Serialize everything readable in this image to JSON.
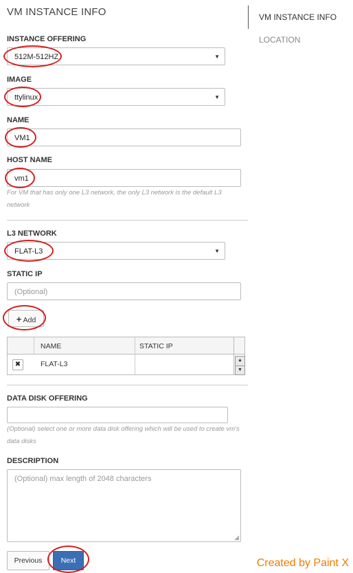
{
  "header": {
    "title": "VM INSTANCE INFO"
  },
  "sidebar": {
    "items": [
      {
        "label": "VM INSTANCE INFO"
      },
      {
        "label": "LOCATION"
      }
    ]
  },
  "form": {
    "instance_offering": {
      "label": "INSTANCE OFFERING",
      "value": "512M-512HZ"
    },
    "image": {
      "label": "IMAGE",
      "value": "ttylinux"
    },
    "name": {
      "label": "NAME",
      "value": "VM1"
    },
    "host_name": {
      "label": "HOST NAME",
      "value": "vm1",
      "hint": "For VM that has only one L3 network, the only L3 network is the default L3 network"
    },
    "l3_network": {
      "label": "L3 NETWORK",
      "value": "FLAT-L3"
    },
    "static_ip": {
      "label": "STATIC IP",
      "placeholder": "(Optional)"
    },
    "add_button": {
      "label": "Add"
    },
    "network_table": {
      "columns": [
        "NAME",
        "STATIC IP"
      ],
      "rows": [
        {
          "name": "FLAT-L3",
          "static_ip": ""
        }
      ]
    },
    "data_disk": {
      "label": "DATA DISK OFFERING",
      "value": "",
      "hint": "(Optional) select one or more data disk offering which will be used to create vm's data disks"
    },
    "description": {
      "label": "DESCRIPTION",
      "placeholder": "(Optional) max length of 2048 characters"
    }
  },
  "buttons": {
    "previous": "Previous",
    "next": "Next"
  },
  "watermark": "Created by Paint X",
  "colors": {
    "primary": "#3a6fb5",
    "annotation": "#d32020",
    "watermark": "#f07c00"
  }
}
